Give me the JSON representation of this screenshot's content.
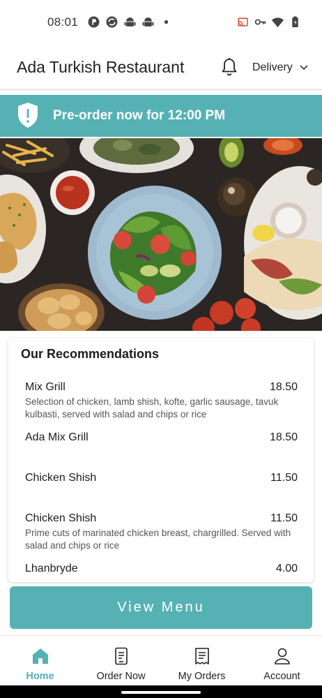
{
  "status_bar": {
    "time": "08:01",
    "left_icons": [
      "p-circle-icon",
      "sync-icon",
      "android-icon",
      "android-icon",
      "dot-icon"
    ],
    "right_icons": [
      "cast-icon",
      "key-icon",
      "wifi-icon",
      "battery-icon"
    ]
  },
  "header": {
    "title": "Ada Turkish Restaurant",
    "notification_icon": "bell-icon",
    "delivery_label": "Delivery"
  },
  "banner": {
    "icon": "shield-alert-icon",
    "text": "Pre-order now for 12:00 PM"
  },
  "recommendations": {
    "title": "Our Recommendations",
    "items": [
      {
        "name": "Mix Grill",
        "price": "18.50",
        "description": "Selection of chicken, lamb shish, kofte, garlic sausage, tavuk kulbasti, served with salad and chips or rice"
      },
      {
        "name": "Ada Mix Grill",
        "price": "18.50",
        "description": ""
      },
      {
        "name": "Chicken Shish",
        "price": "11.50",
        "description": ""
      },
      {
        "name": "Chicken Shish",
        "price": "11.50",
        "description": "Prime cuts of marinated chicken breast, chargrilled. Served with salad and chips or rice"
      },
      {
        "name": "Lhanbryde",
        "price": "4.00",
        "description": ""
      }
    ]
  },
  "view_menu_label": "View Menu",
  "bottom_nav": {
    "items": [
      {
        "label": "Home",
        "icon": "home-icon",
        "active": true
      },
      {
        "label": "Order Now",
        "icon": "order-icon",
        "active": false
      },
      {
        "label": "My Orders",
        "icon": "receipt-icon",
        "active": false
      },
      {
        "label": "Account",
        "icon": "account-icon",
        "active": false
      }
    ]
  },
  "colors": {
    "accent": "#56b1b4",
    "text": "#1c1c1c",
    "muted": "#555555"
  }
}
